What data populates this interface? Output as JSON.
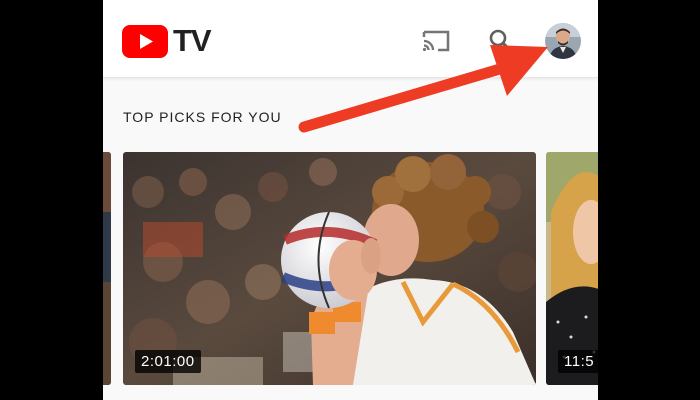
{
  "app": {
    "logo_text": "TV",
    "logo_icon": "youtube-play-icon",
    "brand_color": "#ff0000"
  },
  "header": {
    "cast_icon": "cast-icon",
    "search_icon": "search-icon",
    "avatar": "user-avatar"
  },
  "shelf": {
    "title": "TOP PICKS FOR YOU",
    "cards": [
      {
        "duration": ""
      },
      {
        "duration": "2:01:00"
      },
      {
        "duration": "11:5"
      }
    ]
  },
  "annotation": {
    "arrow_color": "#ee3b24",
    "points_to": "user-avatar"
  }
}
